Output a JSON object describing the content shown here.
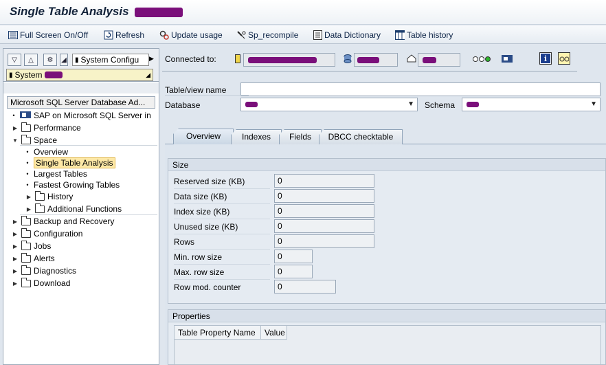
{
  "window": {
    "title": "Single Table Analysis"
  },
  "toolbar": {
    "full_screen": "Full Screen On/Off",
    "refresh": "Refresh",
    "update_usage": "Update usage",
    "sp_recompile": "Sp_recompile",
    "data_dictionary": "Data Dictionary",
    "table_history": "Table history"
  },
  "nav": {
    "system_config_label": "System Configu",
    "system_label": "System",
    "header": "Microsoft SQL Server Database Ad...",
    "items": [
      {
        "label": "SAP on Microsoft SQL Server in"
      },
      {
        "label": "Performance"
      },
      {
        "label": "Space"
      },
      {
        "label": "Overview"
      },
      {
        "label": "Single Table Analysis"
      },
      {
        "label": "Largest Tables"
      },
      {
        "label": "Fastest Growing Tables"
      },
      {
        "label": "History"
      },
      {
        "label": "Additional Functions"
      },
      {
        "label": "Backup and Recovery"
      },
      {
        "label": "Configuration"
      },
      {
        "label": "Jobs"
      },
      {
        "label": "Alerts"
      },
      {
        "label": "Diagnostics"
      },
      {
        "label": "Download"
      }
    ]
  },
  "connection": {
    "label": "Connected to:"
  },
  "form": {
    "table_label": "Table/view name",
    "table_value": "",
    "database_label": "Database",
    "schema_label": "Schema"
  },
  "tabs": [
    {
      "label": "Overview"
    },
    {
      "label": "Indexes"
    },
    {
      "label": "Fields"
    },
    {
      "label": "DBCC checktable"
    }
  ],
  "size": {
    "title": "Size",
    "rows": [
      {
        "label": "Reserved size (KB)",
        "value": "0"
      },
      {
        "label": "Data size (KB)",
        "value": "0"
      },
      {
        "label": "Index size (KB)",
        "value": "0"
      },
      {
        "label": "Unused size (KB)",
        "value": "0"
      },
      {
        "label": "Rows",
        "value": "0"
      },
      {
        "label": "Min. row size",
        "value": "0"
      },
      {
        "label": "Max. row size",
        "value": "0"
      },
      {
        "label": "Row mod. counter",
        "value": "0"
      }
    ]
  },
  "properties": {
    "title": "Properties",
    "columns": [
      "Table Property Name",
      "Value"
    ]
  },
  "colors": {
    "selected_bg": "#fde8a6",
    "redaction": "#7a0f7a"
  }
}
